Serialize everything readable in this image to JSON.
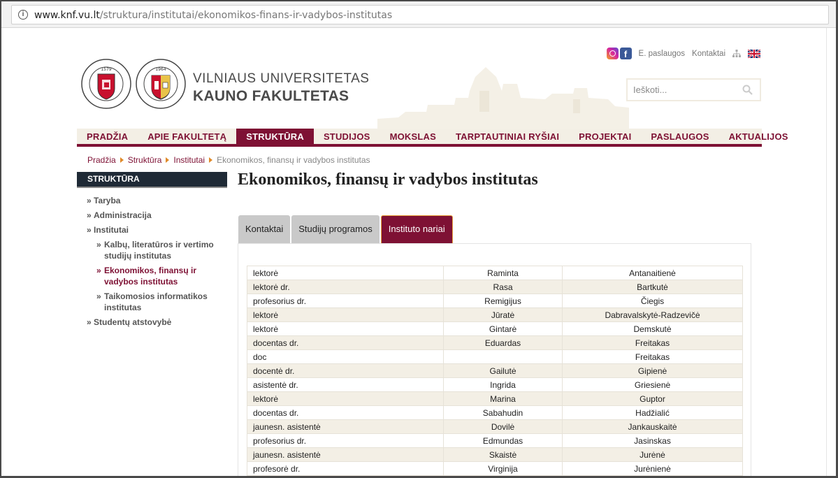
{
  "browser": {
    "url_host": "www.knf.vu.lt",
    "url_path": "/struktura/institutai/ekonomikos-finans-ir-vadybos-institutas"
  },
  "header": {
    "title_line1": "VILNIAUS UNIVERSITETAS",
    "title_line2": "KAUNO FAKULTETAS",
    "seal1_text": "VNIVERSITAS VILNENSIS · 1579",
    "seal2_text": "KAUNO FAKULTETAS · 1964 · VILNIAUS UNIVERSITETAS",
    "links": {
      "eservices": "E. paslaugos",
      "contacts": "Kontaktai"
    },
    "search_placeholder": "Ieškoti...",
    "brand_color": "#7e1134"
  },
  "nav": {
    "items": [
      "PRADŽIA",
      "APIE FAKULTETĄ",
      "STRUKTŪRA",
      "STUDIJOS",
      "MOKSLAS",
      "TARPTAUTINIAI RYŠIAI",
      "PROJEKTAI",
      "PASLAUGOS",
      "AKTUALIJOS"
    ],
    "active_index": 2
  },
  "breadcrumb": {
    "items": [
      "Pradžia",
      "Struktūra",
      "Institutai"
    ],
    "current": "Ekonomikos, finansų ir vadybos institutas"
  },
  "sidebar": {
    "title": "STRUKTŪRA",
    "items": [
      "Taryba",
      "Administracija",
      "Institutai",
      "Kalbų, literatūros ir vertimo studijų institutas",
      "Ekonomikos, finansų ir vadybos institutas",
      "Taikomosios informatikos institutas",
      "Studentų atstovybė"
    ]
  },
  "main": {
    "title": "Ekonomikos, finansų ir vadybos institutas",
    "tabs": [
      "Kontaktai",
      "Studijų programos",
      "Instituto nariai"
    ],
    "active_tab": 2,
    "staff": [
      [
        "lektorė",
        "Raminta",
        "Antanaitienė"
      ],
      [
        "lektorė dr.",
        "Rasa",
        "Bartkutė"
      ],
      [
        "profesorius dr.",
        "Remigijus",
        "Čiegis"
      ],
      [
        "lektorė",
        "Jūratė",
        "Dabravalskytė-Radzevičė"
      ],
      [
        "lektorė",
        "Gintarė",
        "Demskutė"
      ],
      [
        "docentas dr.",
        "Eduardas",
        "Freitakas"
      ],
      [
        "doc",
        "",
        "Freitakas"
      ],
      [
        "docentė dr.",
        "Gailutė",
        "Gipienė"
      ],
      [
        "asistentė dr.",
        "Ingrida",
        "Griesienė"
      ],
      [
        "lektorė",
        "Marina",
        "Guptor"
      ],
      [
        "docentas dr.",
        "Sabahudin",
        "Hadžialić"
      ],
      [
        "jaunesn. asistentė",
        "Dovilė",
        "Jankauskaitė"
      ],
      [
        "profesorius dr.",
        "Edmundas",
        "Jasinskas"
      ],
      [
        "jaunesn. asistentė",
        "Skaistė",
        "Jurėnė"
      ],
      [
        "profesorė dr.",
        "Virginija",
        "Jurėnienė"
      ]
    ]
  }
}
